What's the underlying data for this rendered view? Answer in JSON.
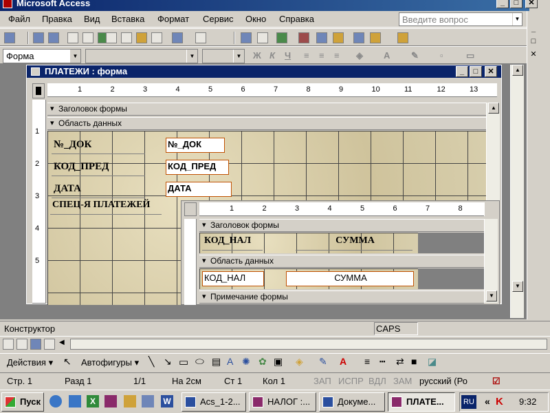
{
  "app": {
    "title": "Microsoft Access"
  },
  "menu": [
    "Файл",
    "Правка",
    "Вид",
    "Вставка",
    "Формат",
    "Сервис",
    "Окно",
    "Справка"
  ],
  "help": {
    "placeholder": "Введите вопрос"
  },
  "format_toolbar": {
    "object": "Форма"
  },
  "form_window": {
    "title": "ПЛАТЕЖИ : форма"
  },
  "ruler_ticks": [
    "1",
    "2",
    "3",
    "4",
    "5",
    "6",
    "7",
    "8",
    "9",
    "10",
    "11",
    "12",
    "13"
  ],
  "vruler_ticks": [
    "1",
    "2",
    "3",
    "4",
    "5"
  ],
  "sections": {
    "header": "Заголовок формы",
    "detail": "Область данных"
  },
  "labels": {
    "doc": "№_ДОК",
    "pred": "КОД_ПРЕД",
    "date": "ДАТА",
    "spec": "СПЕЦ-Я ПЛАТЕЖЕЙ"
  },
  "fields": {
    "doc": "№_ДОК",
    "pred": "КОД_ПРЕД",
    "date": "ДАТА"
  },
  "subform": {
    "ruler_ticks": [
      "1",
      "2",
      "3",
      "4",
      "5",
      "6",
      "7",
      "8"
    ],
    "header": "Заголовок формы",
    "detail": "Область данных",
    "footer": "Примечание формы",
    "label_nal": "КОД_НАЛ",
    "label_sum": "СУММА",
    "field_nal": "КОД_НАЛ",
    "field_sum": "СУММА"
  },
  "status": {
    "mode": "Конструктор",
    "caps": "CAPS"
  },
  "drawing": {
    "actions": "Действия",
    "autoshapes": "Автофигуры"
  },
  "word_status": {
    "page": "Стр. 1",
    "section": "Разд 1",
    "pages": "1/1",
    "at": "На 2см",
    "line": "Ст 1",
    "col": "Кол 1",
    "rec": "ЗАП",
    "trk": "ИСПР",
    "ext": "ВДЛ",
    "ovr": "ЗАМ",
    "lang": "русский (Ро"
  },
  "taskbar": {
    "start": "Пуск",
    "tasks": [
      "Acs_1-2...",
      "НАЛОГ :...",
      "Докуме...",
      "ПЛАТЕ..."
    ],
    "lang": "RU",
    "time": "9:32"
  },
  "colors": {
    "title": "#0a246a",
    "field_border": "#c05000",
    "grid_bg": "#d8cfae"
  }
}
